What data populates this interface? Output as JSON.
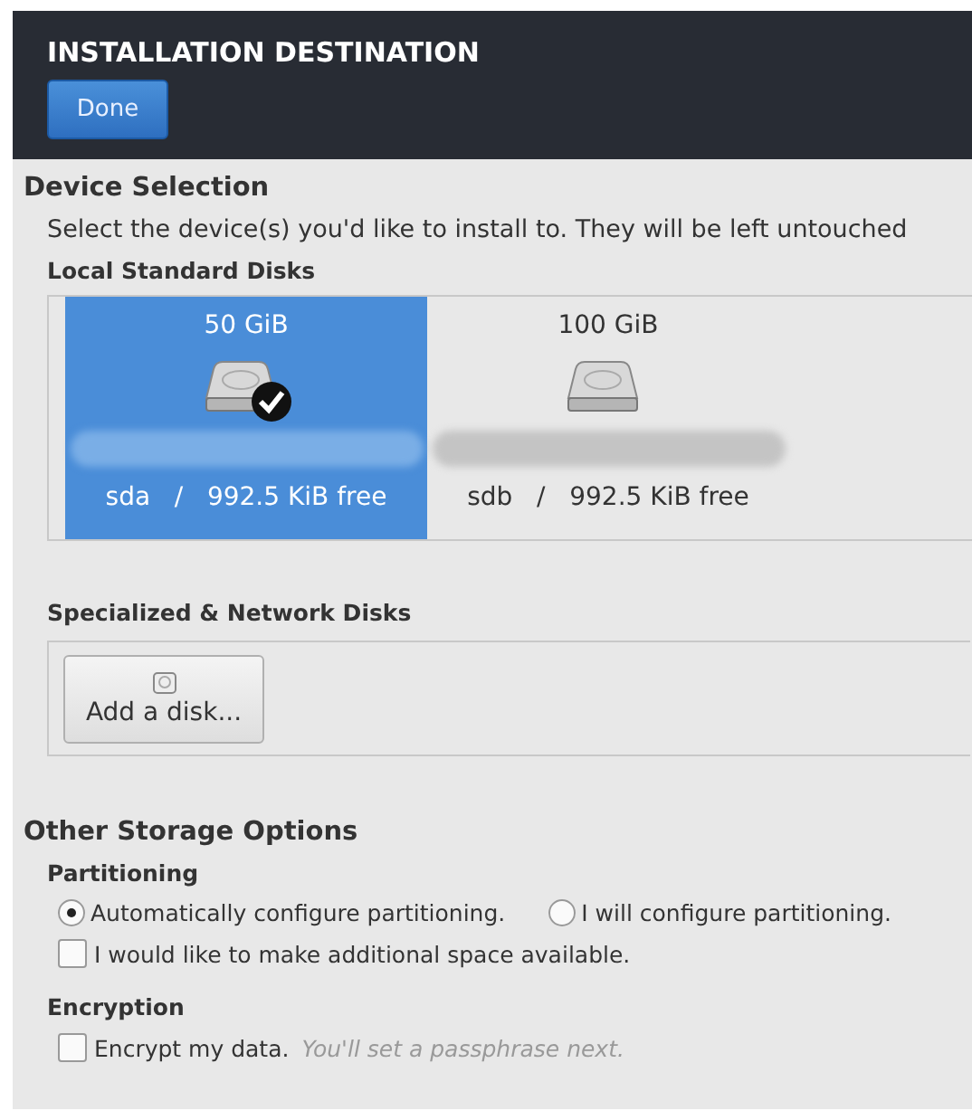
{
  "header": {
    "title": "INSTALLATION DESTINATION",
    "done_button": "Done"
  },
  "device_selection": {
    "heading": "Device Selection",
    "description": "Select the device(s) you'd like to install to.  They will be left untouched",
    "local_heading": "Local Standard Disks",
    "disks": [
      {
        "size": "50 GiB",
        "name": "sda",
        "separator": "/",
        "free": "992.5 KiB free",
        "selected": true
      },
      {
        "size": "100 GiB",
        "name": "sdb",
        "separator": "/",
        "free": "992.5 KiB free",
        "selected": false
      }
    ],
    "network_heading": "Specialized & Network Disks",
    "add_disk_button": "Add a disk..."
  },
  "other_storage": {
    "heading": "Other Storage Options",
    "partitioning_heading": "Partitioning",
    "partitioning_options": [
      {
        "label": "Automatically configure partitioning.",
        "selected": true
      },
      {
        "label": "I will configure partitioning.",
        "selected": false
      }
    ],
    "additional_space": {
      "label": "I would like to make additional space available.",
      "checked": false
    },
    "encryption_heading": "Encryption",
    "encrypt": {
      "label": "Encrypt my data.",
      "hint": "You'll set a passphrase next.",
      "checked": false
    }
  }
}
